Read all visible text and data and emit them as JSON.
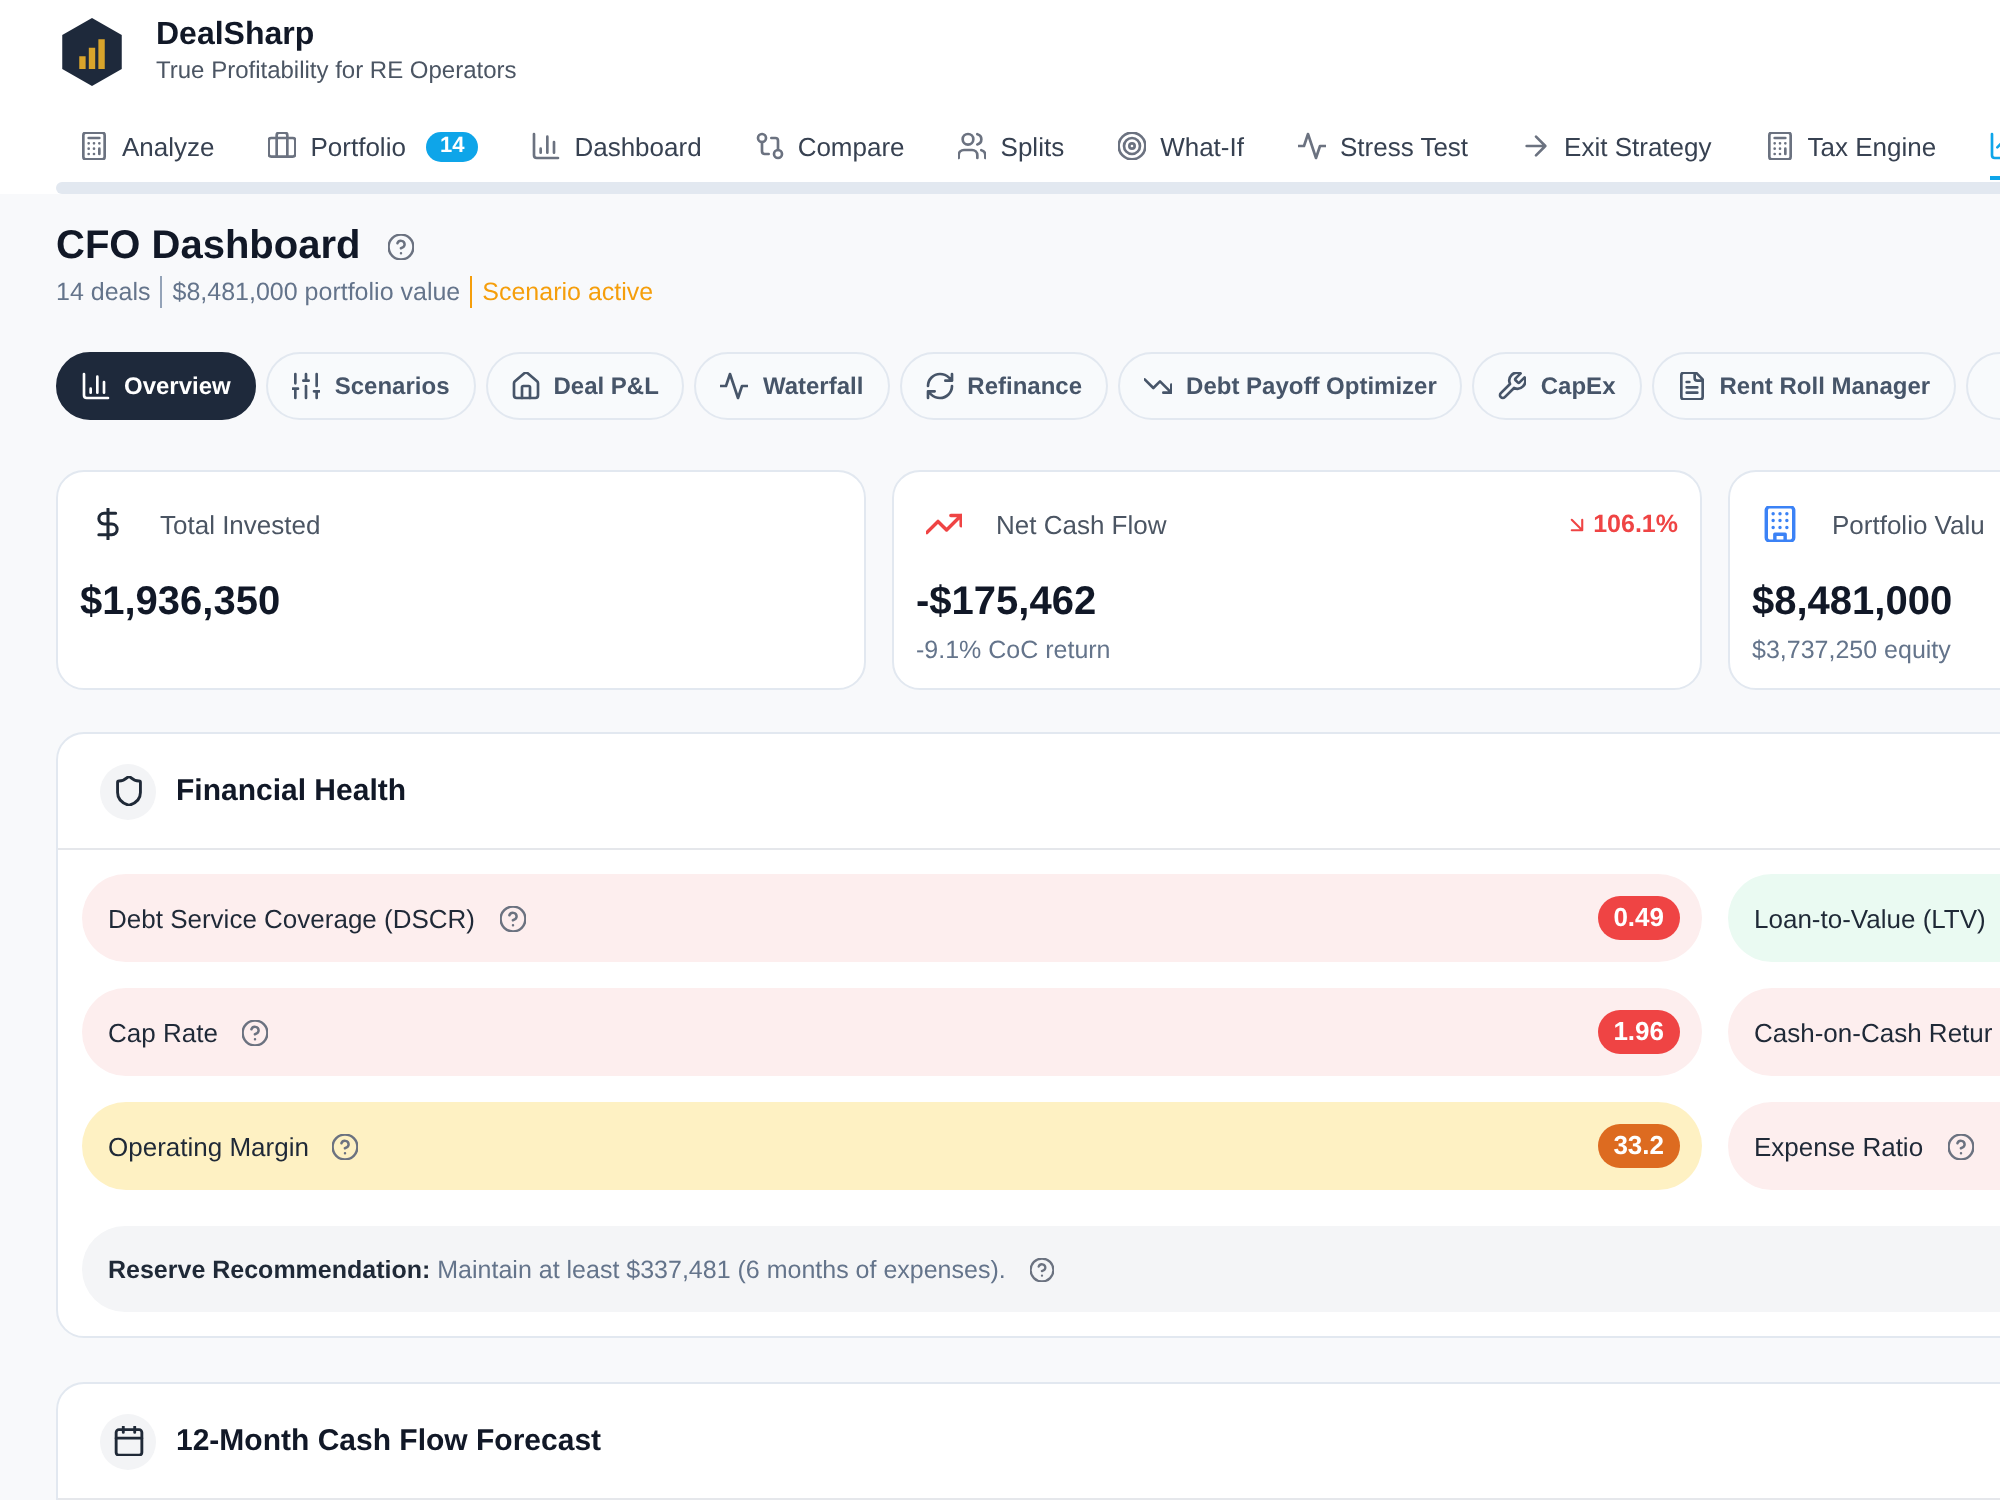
{
  "app": {
    "name": "DealSharp",
    "tagline": "True Profitability for RE Operators"
  },
  "nav_tabs": [
    {
      "label": "Analyze",
      "selected": false
    },
    {
      "label": "Portfolio",
      "badge": "14",
      "selected": false
    },
    {
      "label": "Dashboard",
      "selected": false
    },
    {
      "label": "Compare",
      "selected": false
    },
    {
      "label": "Splits",
      "selected": false
    },
    {
      "label": "What-If",
      "selected": false
    },
    {
      "label": "Stress Test",
      "selected": false
    },
    {
      "label": "Exit Strategy",
      "selected": false
    },
    {
      "label": "Tax Engine",
      "selected": false
    },
    {
      "selected": true
    }
  ],
  "page": {
    "title": "CFO Dashboard",
    "meta": [
      "14 deals",
      "$8,481,000 portfolio value"
    ],
    "scenario_status": "Scenario active"
  },
  "view_tabs": [
    {
      "label": "Overview",
      "selected": true
    },
    {
      "label": "Scenarios",
      "selected": false
    },
    {
      "label": "Deal P&L",
      "selected": false
    },
    {
      "label": "Waterfall",
      "selected": false
    },
    {
      "label": "Refinance",
      "selected": false
    },
    {
      "label": "Debt Payoff Optimizer",
      "selected": false
    },
    {
      "label": "CapEx",
      "selected": false
    },
    {
      "label": "Rent Roll Manager",
      "selected": false
    },
    {
      "selected": false
    }
  ],
  "stat_cards": [
    {
      "label": "Total Invested",
      "value": "$1,936,350"
    },
    {
      "label": "Net Cash Flow",
      "value": "-$175,462",
      "detail": "-9.1% CoC return",
      "trend": {
        "kind": "down",
        "text": "106.1%"
      }
    },
    {
      "label": "Portfolio Valu",
      "value": "$8,481,000",
      "detail": "$3,737,250 equity"
    }
  ],
  "financial_health": {
    "title": "Financial Health",
    "metrics": [
      {
        "kind": "critical",
        "label": "Debt Service Coverage (DSCR)",
        "help": true,
        "value": "0.49"
      },
      {
        "kind": "healthy",
        "label": "Loan-to-Value (LTV)",
        "help": false
      },
      {
        "kind": "critical",
        "label": "Cap Rate",
        "help": true,
        "value": "1.96"
      },
      {
        "kind": "critical",
        "label": "Cash-on-Cash Retur",
        "help": false
      },
      {
        "kind": "warning",
        "label": "Operating Margin",
        "help": true,
        "value": "33.2"
      },
      {
        "kind": "critical",
        "label": "Expense Ratio",
        "help": true
      }
    ],
    "reserve": "**Reserve Recommendation:** Maintain at least $337,481 (6 months of expenses)."
  },
  "cash_flow_forecast": {
    "title": "12-Month Cash Flow Forecast"
  }
}
